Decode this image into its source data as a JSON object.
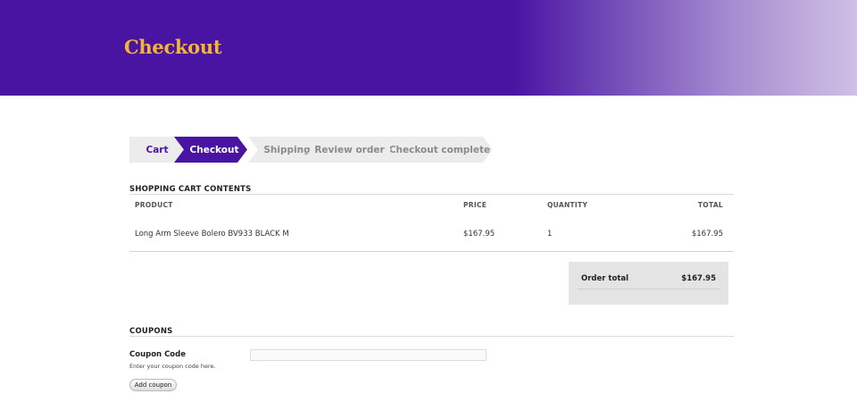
{
  "header": {
    "title": "Checkout"
  },
  "steps": [
    {
      "label": "Cart",
      "state": "done"
    },
    {
      "label": "Checkout",
      "state": "active"
    },
    {
      "label": "Shipping",
      "state": "upcoming"
    },
    {
      "label": "Review order",
      "state": "upcoming"
    },
    {
      "label": "Checkout complete",
      "state": "upcoming"
    }
  ],
  "cart": {
    "section_title": "SHOPPING CART CONTENTS",
    "columns": {
      "product": "PRODUCT",
      "price": "PRICE",
      "quantity": "QUANTITY",
      "total": "TOTAL"
    },
    "rows": [
      {
        "product": "Long Arm Sleeve Bolero BV933 BLACK M",
        "price": "$167.95",
        "quantity": "1",
        "total": "$167.95"
      }
    ]
  },
  "order_total": {
    "label": "Order total",
    "value": "$167.95"
  },
  "coupons": {
    "section_title": "COUPONS",
    "field_label": "Coupon Code",
    "help_text": "Enter your coupon code here.",
    "input_value": "",
    "button_label": "Add coupon"
  },
  "colors": {
    "brand_purple": "#4a14a3",
    "title_gold": "#f3b538",
    "step_inactive": "#ececec",
    "order_box": "#e4e4e4"
  }
}
